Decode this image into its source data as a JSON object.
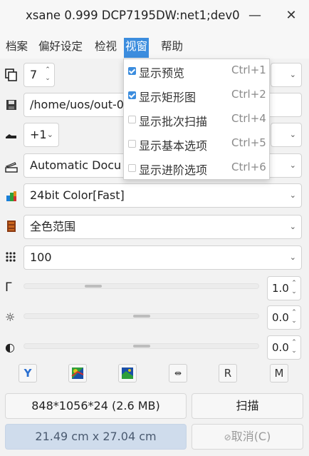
{
  "window": {
    "title": "xsane 0.999 DCP7195DW:net1;dev0",
    "minimize_glyph": "—",
    "close_glyph": "✕"
  },
  "menubar": {
    "items": [
      "档案",
      "偏好设定",
      "检视",
      "视窗",
      "帮助"
    ],
    "active_index": 3
  },
  "controls": {
    "copies": {
      "value": "7",
      "icon": "copies-icon"
    },
    "filename": {
      "value": "/home/uos/out-0",
      "icon": "floppy-save-icon"
    },
    "step": {
      "value": "+1",
      "icon": "step-increment-icon"
    },
    "source": {
      "value": "Automatic Docu",
      "icon": "scanner-source-icon"
    },
    "mode": {
      "value": "24bit Color[Fast]",
      "icon": "color-mode-icon"
    },
    "range": {
      "value": "全色范围",
      "icon": "color-range-icon"
    },
    "resolution": {
      "value": "100",
      "icon": "resolution-icon"
    }
  },
  "sliders": [
    {
      "name": "gamma",
      "icon_glyph": "Γ",
      "value": "1.0",
      "level": 0.28
    },
    {
      "name": "brightness",
      "icon_glyph": "☼",
      "value": "0.0",
      "level": 0.5
    },
    {
      "name": "contrast",
      "icon_glyph": "◐",
      "value": "0.0",
      "level": 0.5
    }
  ],
  "toolbar": {
    "tools": [
      "Y",
      "",
      "",
      "⇹",
      "R",
      "M"
    ]
  },
  "status": {
    "image_info": "848*1056*24 (2.6 MB)",
    "scan_label": "扫描",
    "dimensions": "21.49 cm x 27.04 cm",
    "cancel_label": "取消(C)",
    "cancel_glyph": "⊘"
  },
  "dropdown_menu": {
    "items": [
      {
        "label": "显示预览",
        "shortcut": "Ctrl+1",
        "checked": true
      },
      {
        "label": "显示矩形图",
        "shortcut": "Ctrl+2",
        "checked": true
      },
      {
        "label": "显示批次扫描",
        "shortcut": "Ctrl+4",
        "checked": false
      },
      {
        "label": "显示基本选项",
        "shortcut": "Ctrl+5",
        "checked": false
      },
      {
        "label": "显示进阶选项",
        "shortcut": "Ctrl+6",
        "checked": false
      }
    ]
  },
  "colors": {
    "accent": "#3c8dde",
    "window_bg": "#f2f2f2"
  }
}
